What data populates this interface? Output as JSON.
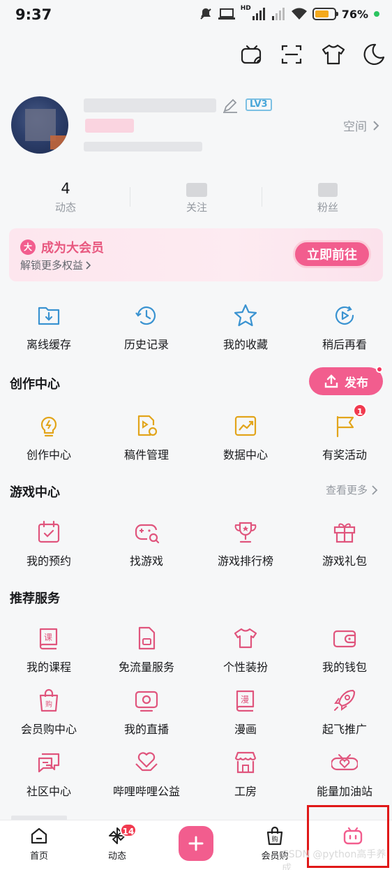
{
  "status_bar": {
    "time": "9:37",
    "network": "HD",
    "battery_percent": "76%"
  },
  "top_icons": [
    "tv-cast-icon",
    "scan-icon",
    "tshirt-icon",
    "moon-icon"
  ],
  "profile": {
    "level": "LV3",
    "space_label": "空间"
  },
  "stats": [
    {
      "num": "4",
      "label": "动态"
    },
    {
      "num": "",
      "label": "关注"
    },
    {
      "num": "",
      "label": "粉丝"
    }
  ],
  "vip": {
    "badge": "大",
    "title": "成为大会员",
    "subtitle": "解锁更多权益",
    "button": "立即前往"
  },
  "quick": [
    {
      "icon": "download-folder-icon",
      "label": "离线缓存"
    },
    {
      "icon": "history-clock-icon",
      "label": "历史记录"
    },
    {
      "icon": "star-icon",
      "label": "我的收藏"
    },
    {
      "icon": "watch-later-icon",
      "label": "稍后再看"
    }
  ],
  "creator": {
    "title": "创作中心",
    "publish": "发布",
    "items": [
      {
        "icon": "lightbulb-icon",
        "label": "创作中心"
      },
      {
        "icon": "manuscript-icon",
        "label": "稿件管理"
      },
      {
        "icon": "chart-icon",
        "label": "数据中心"
      },
      {
        "icon": "flag-icon",
        "label": "有奖活动",
        "badge": "1"
      }
    ]
  },
  "games": {
    "title": "游戏中心",
    "more": "查看更多",
    "items": [
      {
        "icon": "calendar-check-icon",
        "label": "我的预约"
      },
      {
        "icon": "gamepad-search-icon",
        "label": "找游戏"
      },
      {
        "icon": "trophy-icon",
        "label": "游戏排行榜"
      },
      {
        "icon": "gift-icon",
        "label": "游戏礼包"
      }
    ]
  },
  "services": {
    "title": "推荐服务",
    "items": [
      {
        "icon": "course-book-icon",
        "label": "我的课程"
      },
      {
        "icon": "sim-card-icon",
        "label": "免流量服务"
      },
      {
        "icon": "tshirt-icon",
        "label": "个性装扮"
      },
      {
        "icon": "wallet-icon",
        "label": "我的钱包"
      },
      {
        "icon": "shopping-bag-icon",
        "label": "会员购中心"
      },
      {
        "icon": "live-tv-icon",
        "label": "我的直播"
      },
      {
        "icon": "comic-book-icon",
        "label": "漫画"
      },
      {
        "icon": "rocket-icon",
        "label": "起飞推广"
      },
      {
        "icon": "chat-bubbles-icon",
        "label": "社区中心"
      },
      {
        "icon": "heart-hands-icon",
        "label": "哔哩哔哩公益"
      },
      {
        "icon": "shop-icon",
        "label": "工房"
      },
      {
        "icon": "energy-station-icon",
        "label": "能量加油站"
      }
    ]
  },
  "nav": [
    {
      "icon": "home-icon",
      "label": "首页"
    },
    {
      "icon": "pinwheel-icon",
      "label": "动态",
      "badge": "14"
    },
    {
      "icon": "plus-icon",
      "label": ""
    },
    {
      "icon": "shopping-bag-icon",
      "label": "会员购"
    },
    {
      "icon": "bilibili-tv-icon",
      "label": ""
    }
  ],
  "watermark": "CSDN @python高手养成",
  "colors": {
    "accent": "#f25d8e",
    "blue": "#3a93d1",
    "gold": "#e2a51b",
    "pink": "#e0557d"
  }
}
